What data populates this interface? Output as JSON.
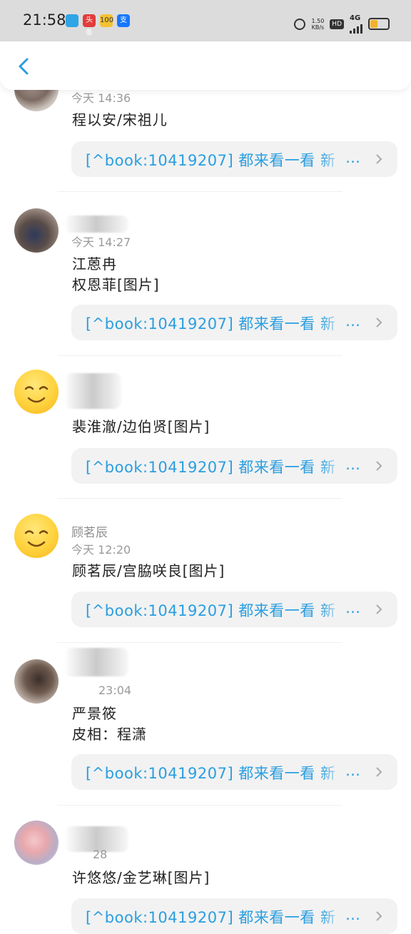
{
  "status_bar": {
    "time": "21:58",
    "net_speed_value": "1.50",
    "net_speed_unit": "KB/s",
    "hd_label": "HD",
    "network": "4G",
    "app_icons": [
      "message-icon",
      "news-icon",
      "calendar-icon",
      "alipay-icon"
    ],
    "app_icon_texts": [
      "",
      "头条",
      "100",
      "支"
    ]
  },
  "nav": {
    "back_icon": "back-chevron-icon",
    "accent": "#2a9ee0"
  },
  "posts": [
    {
      "name": "",
      "time": "今天 14:36",
      "lines": [
        "程以安/宋祖儿"
      ],
      "card": "[^book:10419207]  都来看一看  新"
    },
    {
      "name": "",
      "time": "今天 14:27",
      "lines": [
        "江蒽冉",
        "权恩菲[图片]"
      ],
      "card": "[^book:10419207]  都来看一看  新"
    },
    {
      "name": "",
      "time": "",
      "lines": [
        "裴淮澈/边伯贤[图片]"
      ],
      "card": "[^book:10419207]  都来看一看  新"
    },
    {
      "name": "顾茗辰",
      "time": "今天 12:20",
      "lines": [
        "顾茗辰/宫脇咲良[图片]"
      ],
      "card": "[^book:10419207]  都来看一看  新"
    },
    {
      "name": "",
      "time": "23:04",
      "lines": [
        "严景筱",
        "皮相：程潇"
      ],
      "card": "[^book:10419207]  都来看一看  新"
    },
    {
      "name": "",
      "time": "28",
      "lines": [
        "许悠悠/金艺琳[图片]"
      ],
      "card": "[^book:10419207]  都来看一看  新"
    }
  ],
  "card_ellipsis": "…"
}
